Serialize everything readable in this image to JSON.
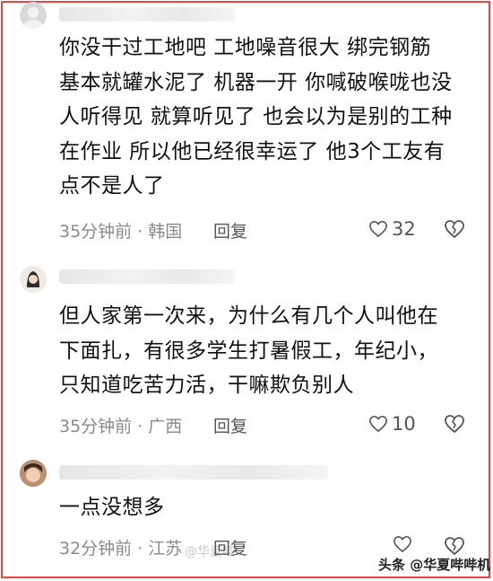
{
  "comments": [
    {
      "text": "你没干过工地吧  工地噪音很大 绑完钢筋\n基本就罐水泥了 机器一开 你喊破喉咙也没\n人听得见 就算听见了 也会以为是别的工种\n在作业 所以他已经很幸运了 他3个工友有\n点不是人了",
      "meta": "35分钟前 · 韩国",
      "reply_label": "回复",
      "likes": "32",
      "avatar_icon": "blurred-avatar"
    },
    {
      "text": "但人家第一次来，为什么有几个人叫他在\n下面扎，有很多学生打暑假工，年纪小，\n只知道吃苦力活，干嘛欺负别人",
      "meta": "35分钟前 · 广西",
      "reply_label": "回复",
      "likes": "10",
      "avatar_icon": "cartoon-avatar"
    },
    {
      "text": "一点没想多",
      "meta": "32分钟前 · 江苏",
      "reply_label": "回复",
      "likes": "",
      "avatar_icon": "child-avatar"
    }
  ],
  "watermark": "头条 @华夏哔哔机",
  "faint_watermark": "@华夏哔",
  "colors": {
    "border": "#e8443c",
    "text": "#111111",
    "meta": "#8a8a8a"
  }
}
